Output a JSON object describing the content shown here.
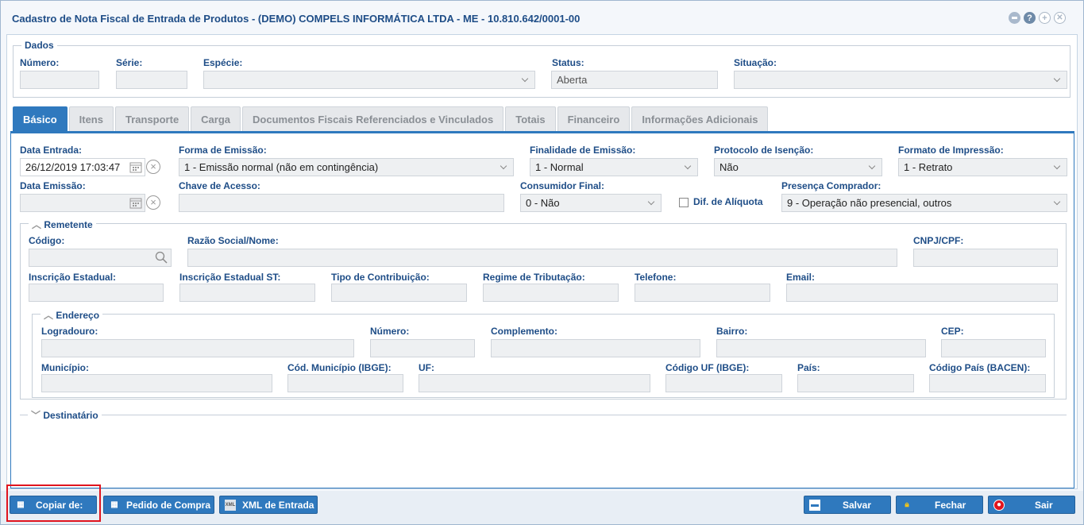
{
  "window": {
    "title": "Cadastro de Nota Fiscal de Entrada de Produtos - (DEMO) COMPELS INFORMÁTICA LTDA - ME - 10.810.642/0001-00",
    "icons": [
      "minimize-icon",
      "help-icon",
      "maximize-icon",
      "close-icon"
    ]
  },
  "dados": {
    "legend": "Dados",
    "numero_label": "Número:",
    "numero_value": "",
    "serie_label": "Série:",
    "serie_value": "",
    "especie_label": "Espécie:",
    "especie_value": "",
    "status_label": "Status:",
    "status_value": "Aberta",
    "situacao_label": "Situação:",
    "situacao_value": ""
  },
  "tabs": [
    "Básico",
    "Itens",
    "Transporte",
    "Carga",
    "Documentos Fiscais Referenciados e Vinculados",
    "Totais",
    "Financeiro",
    "Informações Adicionais"
  ],
  "basico": {
    "data_entrada_label": "Data Entrada:",
    "data_entrada_value": "26/12/2019 17:03:47",
    "forma_emissao_label": "Forma de Emissão:",
    "forma_emissao_value": "1 - Emissão normal (não em contingência)",
    "finalidade_label": "Finalidade de Emissão:",
    "finalidade_value": "1 - Normal",
    "protocolo_label": "Protocolo de Isenção:",
    "protocolo_value": "Não",
    "formato_label": "Formato de Impressão:",
    "formato_value": "1 - Retrato",
    "data_emissao_label": "Data Emissão:",
    "data_emissao_value": "",
    "chave_label": "Chave de Acesso:",
    "chave_value": "",
    "consumidor_label": "Consumidor Final:",
    "consumidor_value": "0 - Não",
    "dif_aliquota_label": "Dif. de Alíquota",
    "presenca_label": "Presença Comprador:",
    "presenca_value": "9 - Operação não presencial, outros"
  },
  "remetente": {
    "legend": "Remetente",
    "codigo_label": "Código:",
    "razao_label": "Razão Social/Nome:",
    "cnpj_label": "CNPJ/CPF:",
    "ie_label": "Inscrição Estadual:",
    "iest_label": "Inscrição Estadual ST:",
    "tipo_contrib_label": "Tipo de Contribuição:",
    "regime_label": "Regime de Tributação:",
    "telefone_label": "Telefone:",
    "email_label": "Email:"
  },
  "endereco": {
    "legend": "Endereço",
    "logradouro_label": "Logradouro:",
    "numero_label": "Número:",
    "complemento_label": "Complemento:",
    "bairro_label": "Bairro:",
    "cep_label": "CEP:",
    "municipio_label": "Município:",
    "cod_municipio_label": "Cód. Município (IBGE):",
    "uf_label": "UF:",
    "codigo_uf_label": "Código UF (IBGE):",
    "pais_label": "País:",
    "codigo_pais_label": "Código País (BACEN):"
  },
  "destinatario": {
    "legend": "Destinatário"
  },
  "footer": {
    "copiar": "Copiar de:",
    "pedido": "Pedido de Compra",
    "xml": "XML de Entrada",
    "salvar": "Salvar",
    "fechar": "Fechar",
    "sair": "Sair"
  },
  "colors": {
    "accent": "#2f79be",
    "label": "#1e4d87",
    "highlight": "#e0141e"
  }
}
